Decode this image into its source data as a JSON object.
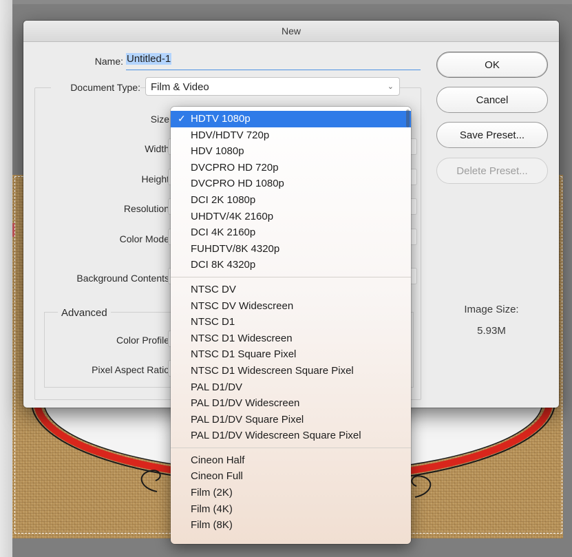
{
  "dialog": {
    "title": "New",
    "name_label": "Name:",
    "name_value": "Untitled-1",
    "doc_type_label": "Document Type:",
    "doc_type_value": "Film & Video",
    "labels": {
      "size": "Size",
      "width": "Width",
      "height": "Height",
      "resolution": "Resolution",
      "color_mode": "Color Mode",
      "background_contents": "Background Contents",
      "advanced": "Advanced",
      "color_profile": "Color Profile",
      "pixel_aspect_ratio": "Pixel Aspect Ratio"
    },
    "buttons": {
      "ok": "OK",
      "cancel": "Cancel",
      "save_preset": "Save Preset...",
      "delete_preset": "Delete Preset..."
    },
    "image_size_label": "Image Size:",
    "image_size_value": "5.93M"
  },
  "size_dropdown": {
    "check_mark": "✓",
    "groups": [
      [
        "HDTV 1080p",
        "HDV/HDTV 720p",
        "HDV 1080p",
        "DVCPRO HD 720p",
        "DVCPRO HD 1080p",
        "DCI 2K 1080p",
        "UHDTV/4K 2160p",
        "DCI 4K 2160p",
        "FUHDTV/8K 4320p",
        "DCI 8K 4320p"
      ],
      [
        "NTSC DV",
        "NTSC DV Widescreen",
        "NTSC D1",
        "NTSC D1 Widescreen",
        "NTSC D1 Square Pixel",
        "NTSC D1 Widescreen Square Pixel",
        "PAL D1/DV",
        "PAL D1/DV Widescreen",
        "PAL D1/DV Square Pixel",
        "PAL D1/DV Widescreen Square Pixel"
      ],
      [
        "Cineon Half",
        "Cineon Full",
        "Film (2K)",
        "Film (4K)",
        "Film (8K)"
      ]
    ],
    "selected": "HDTV 1080p"
  },
  "colors": {
    "selection": "#2f7be8",
    "canvas_burlap": "#b8935a",
    "accent_red": "#d9261c"
  }
}
